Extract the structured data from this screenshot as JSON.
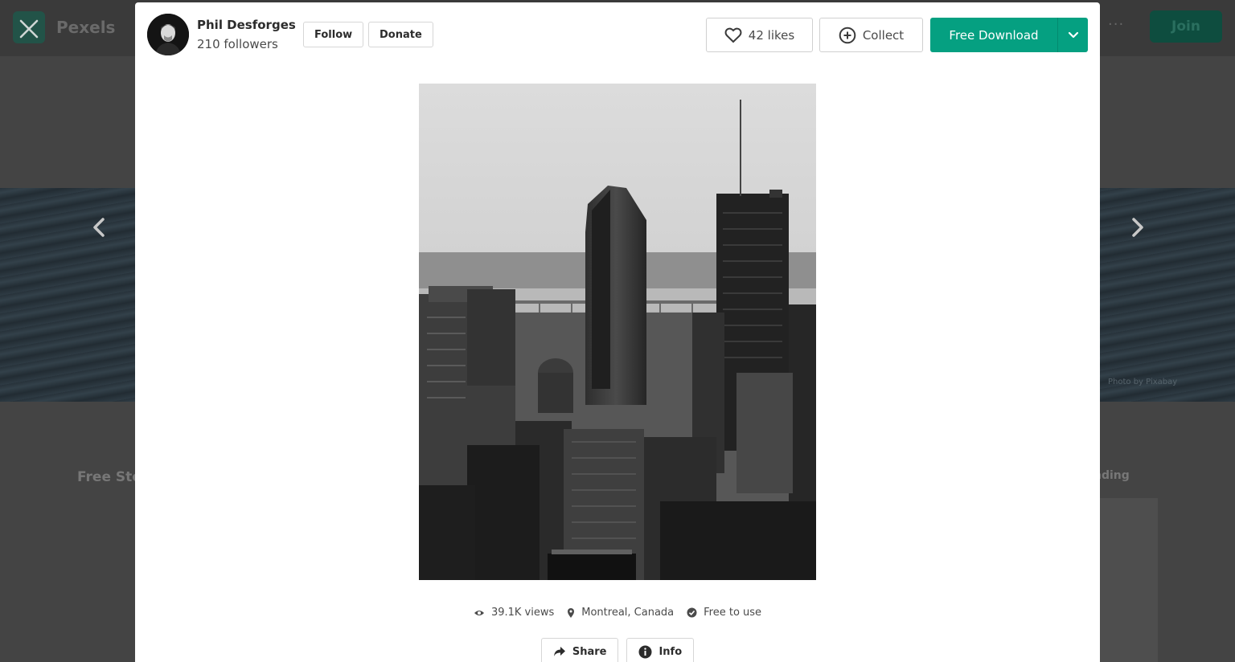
{
  "background": {
    "brand": "Pexels",
    "join_label": "Join",
    "more_label": "···",
    "section_title": "Free Sto",
    "sort_label": "nding",
    "hero_credit": "Photo by Pixabay"
  },
  "modal": {
    "author": {
      "name": "Phil Desforges",
      "followers": "210 followers"
    },
    "follow_label": "Follow",
    "donate_label": "Donate",
    "likes_label": "42 likes",
    "collect_label": "Collect",
    "download_label": "Free Download",
    "photo": {
      "subject": "Black and white Montreal skyline"
    },
    "meta": {
      "views": "39.1K views",
      "location": "Montreal, Canada",
      "license": "Free to use"
    },
    "share_label": "Share",
    "info_label": "Info"
  },
  "colors": {
    "accent": "#05a081",
    "overlay": "#2a2a2a"
  }
}
